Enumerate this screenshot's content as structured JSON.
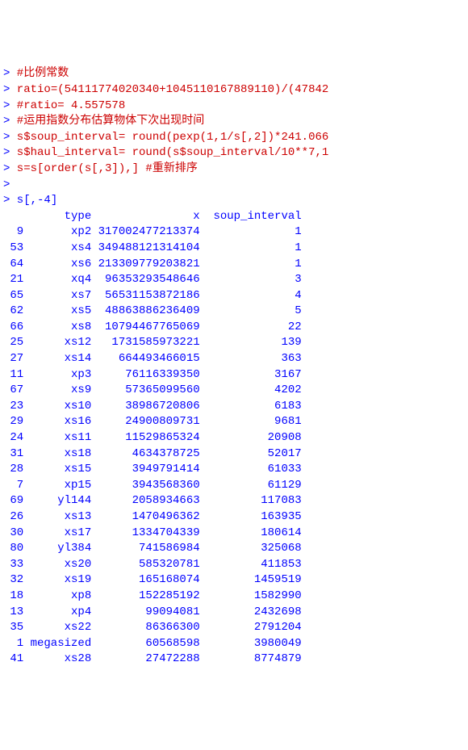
{
  "console": {
    "lines": [
      {
        "prompt": ">",
        "text": " #比例常数",
        "color": "red"
      },
      {
        "prompt": ">",
        "text": " ratio=(54111774020340+1045110167889110)/(47842",
        "color": "red"
      },
      {
        "prompt": ">",
        "text": " #ratio= 4.557578",
        "color": "red"
      },
      {
        "prompt": ">",
        "text": " #运用指数分布估算物体下次出现时间",
        "color": "red"
      },
      {
        "prompt": ">",
        "text": " s$soup_interval= round(pexp(1,1/s[,2])*241.066",
        "color": "red"
      },
      {
        "prompt": ">",
        "text": " s$haul_interval= round(s$soup_interval/10**7,1",
        "color": "red"
      },
      {
        "prompt": ">",
        "text": " s=s[order(s[,3]),] #重新排序",
        "color": "red"
      },
      {
        "prompt": ">",
        "text": "",
        "color": "blue"
      },
      {
        "prompt": ">",
        "text": " s[,-4]",
        "color": "blue"
      }
    ]
  },
  "table": {
    "header": {
      "rowid": "",
      "type": "type",
      "x": "x",
      "soup_interval": "soup_interval"
    },
    "rows": [
      {
        "rowid": "9",
        "type": "xp2",
        "x": "317002477213374",
        "soup_interval": "1"
      },
      {
        "rowid": "53",
        "type": "xs4",
        "x": "349488121314104",
        "soup_interval": "1"
      },
      {
        "rowid": "64",
        "type": "xs6",
        "x": "213309779203821",
        "soup_interval": "1"
      },
      {
        "rowid": "21",
        "type": "xq4",
        "x": "96353293548646",
        "soup_interval": "3"
      },
      {
        "rowid": "65",
        "type": "xs7",
        "x": "56531153872186",
        "soup_interval": "4"
      },
      {
        "rowid": "62",
        "type": "xs5",
        "x": "48863886236409",
        "soup_interval": "5"
      },
      {
        "rowid": "66",
        "type": "xs8",
        "x": "10794467765069",
        "soup_interval": "22"
      },
      {
        "rowid": "25",
        "type": "xs12",
        "x": "1731585973221",
        "soup_interval": "139"
      },
      {
        "rowid": "27",
        "type": "xs14",
        "x": "664493466015",
        "soup_interval": "363"
      },
      {
        "rowid": "11",
        "type": "xp3",
        "x": "76116339350",
        "soup_interval": "3167"
      },
      {
        "rowid": "67",
        "type": "xs9",
        "x": "57365099560",
        "soup_interval": "4202"
      },
      {
        "rowid": "23",
        "type": "xs10",
        "x": "38986720806",
        "soup_interval": "6183"
      },
      {
        "rowid": "29",
        "type": "xs16",
        "x": "24900809731",
        "soup_interval": "9681"
      },
      {
        "rowid": "24",
        "type": "xs11",
        "x": "11529865324",
        "soup_interval": "20908"
      },
      {
        "rowid": "31",
        "type": "xs18",
        "x": "4634378725",
        "soup_interval": "52017"
      },
      {
        "rowid": "28",
        "type": "xs15",
        "x": "3949791414",
        "soup_interval": "61033"
      },
      {
        "rowid": "7",
        "type": "xp15",
        "x": "3943568360",
        "soup_interval": "61129"
      },
      {
        "rowid": "69",
        "type": "yl144",
        "x": "2058934663",
        "soup_interval": "117083"
      },
      {
        "rowid": "26",
        "type": "xs13",
        "x": "1470496362",
        "soup_interval": "163935"
      },
      {
        "rowid": "30",
        "type": "xs17",
        "x": "1334704339",
        "soup_interval": "180614"
      },
      {
        "rowid": "80",
        "type": "yl384",
        "x": "741586984",
        "soup_interval": "325068"
      },
      {
        "rowid": "33",
        "type": "xs20",
        "x": "585320781",
        "soup_interval": "411853"
      },
      {
        "rowid": "32",
        "type": "xs19",
        "x": "165168074",
        "soup_interval": "1459519"
      },
      {
        "rowid": "18",
        "type": "xp8",
        "x": "152285192",
        "soup_interval": "1582990"
      },
      {
        "rowid": "13",
        "type": "xp4",
        "x": "99094081",
        "soup_interval": "2432698"
      },
      {
        "rowid": "35",
        "type": "xs22",
        "x": "86366300",
        "soup_interval": "2791204"
      },
      {
        "rowid": "1",
        "type": "megasized",
        "x": "60568598",
        "soup_interval": "3980049"
      },
      {
        "rowid": "41",
        "type": "xs28",
        "x": "27472288",
        "soup_interval": "8774879"
      }
    ]
  }
}
